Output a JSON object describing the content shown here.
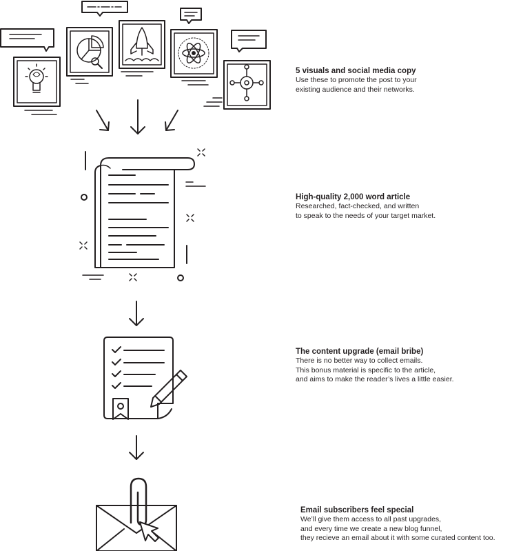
{
  "steps": [
    {
      "title": "5 visuals and social media copy",
      "lines": [
        "Use these to promote the post to your",
        "existing audience and their networks."
      ]
    },
    {
      "title": "High-quality 2,000 word article",
      "lines": [
        "Researched, fact-checked, and written",
        "to speak to the needs of your target market."
      ]
    },
    {
      "title": "The content upgrade (email bribe)",
      "lines": [
        "There is no better way to collect emails.",
        "This bonus material is specific to the article,",
        "and aims to make the reader’s lives a little easier."
      ]
    },
    {
      "title": "Email subscribers feel special",
      "lines": [
        "We’ll give them access to all past upgrades,",
        "and every time we create a new blog funnel,",
        "they recieve an email about it with some curated content too."
      ]
    }
  ],
  "colors": {
    "ink": "#231f20",
    "background": "#ffffff"
  },
  "icons": [
    "lightbulb-icon",
    "pie-chart-icon",
    "rocket-icon",
    "atom-icon",
    "target-icon",
    "scroll-document-icon",
    "checklist-icon",
    "pencil-icon",
    "ribbon-badge-icon",
    "envelope-icon",
    "paperclip-icon",
    "cursor-icon"
  ]
}
